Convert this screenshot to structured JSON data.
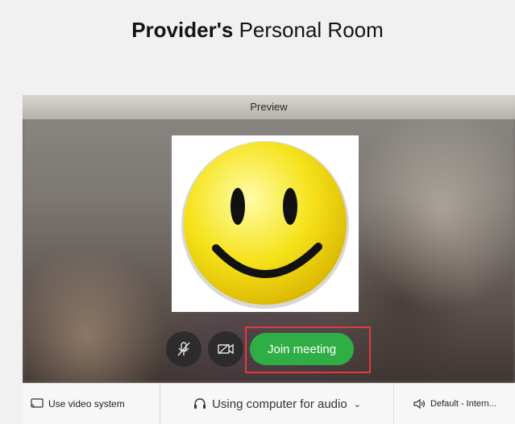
{
  "title": {
    "owner": "Provider's",
    "room": "Personal Room"
  },
  "preview": {
    "label": "Preview"
  },
  "controls": {
    "mute_icon": "mic-muted-icon",
    "video_icon": "video-off-icon",
    "join_label": "Join meeting"
  },
  "footer": {
    "video_system_label": "Use video system",
    "audio_label": "Using computer for audio",
    "speaker_label": "Default - Intern..."
  },
  "colors": {
    "join": "#2fae46",
    "highlight": "#e23b3b",
    "smiley": "#f5d800"
  }
}
